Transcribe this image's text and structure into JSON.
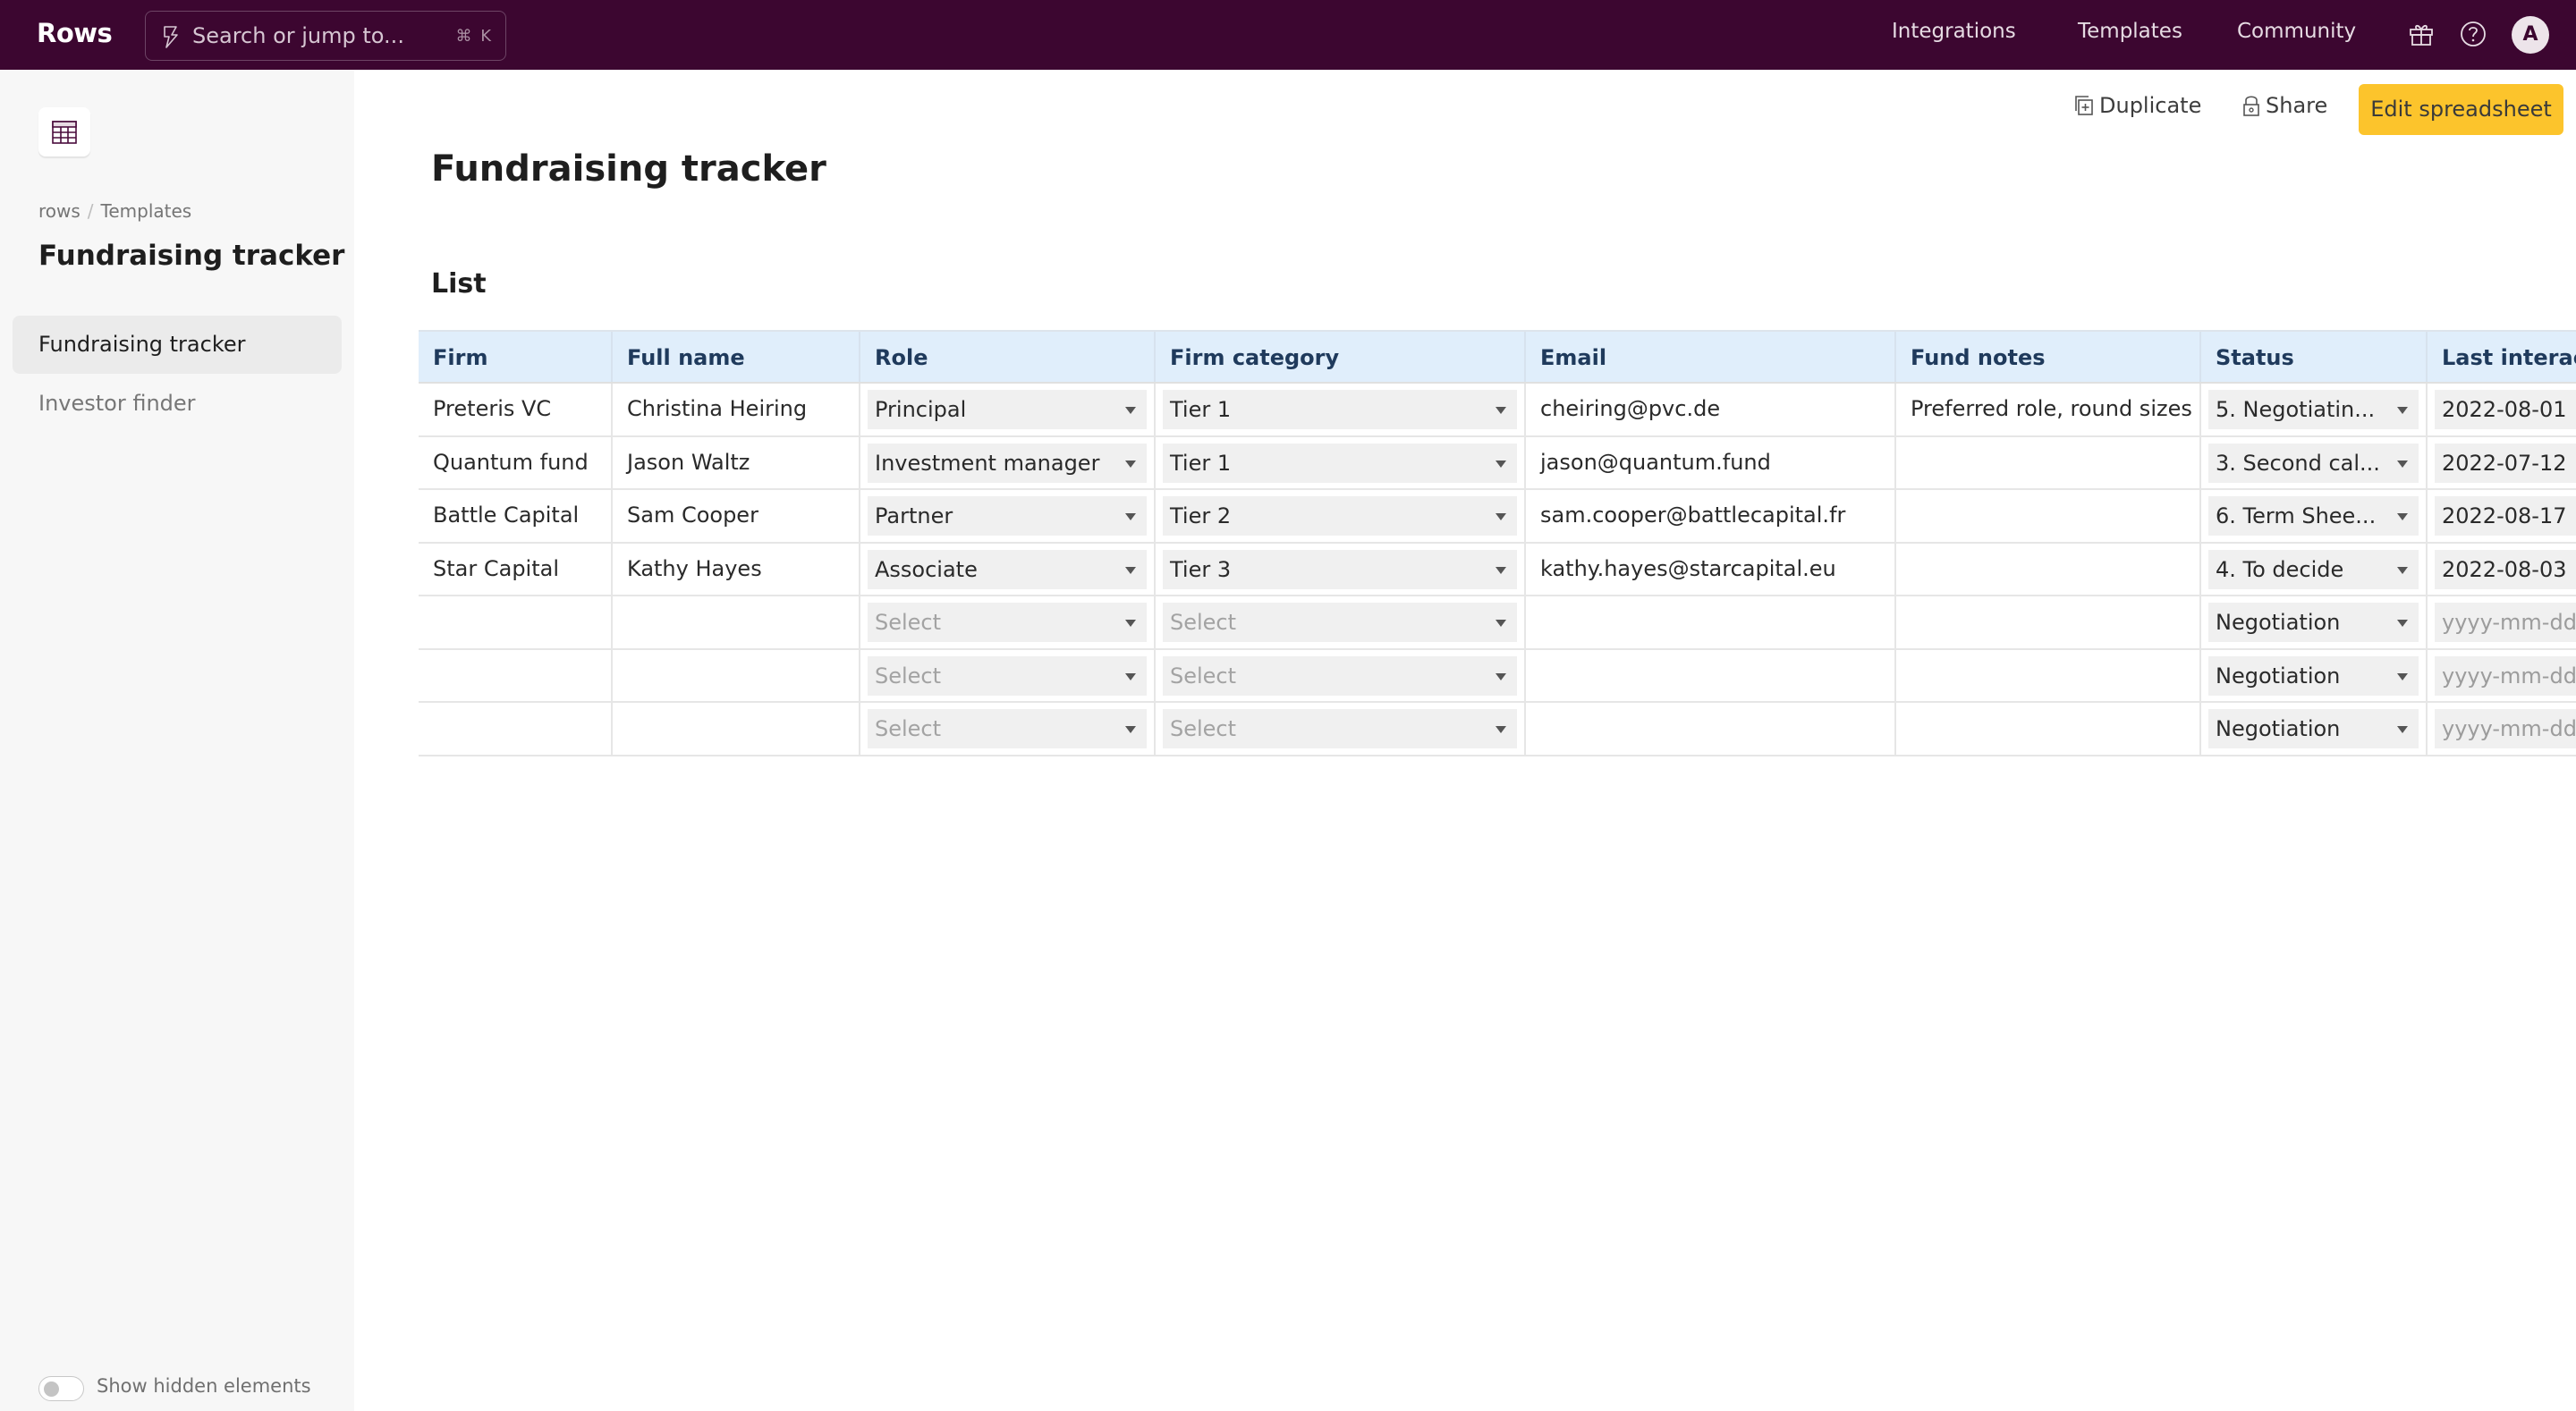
{
  "topbar": {
    "logo": "Rows",
    "search_placeholder": "Search or jump to...",
    "search_shortcut": "⌘ K",
    "nav": [
      "Integrations",
      "Templates",
      "Community"
    ],
    "avatar_initial": "A",
    "bg_color": "#3c0630"
  },
  "sidebar": {
    "breadcrumb": [
      "rows",
      "Templates"
    ],
    "title": "Fundraising tracker",
    "items": [
      {
        "label": "Fundraising tracker",
        "active": true
      },
      {
        "label": "Investor finder",
        "active": false
      }
    ],
    "toggle_label": "Show hidden elements",
    "toggle_on": false
  },
  "actions": {
    "duplicate": "Duplicate",
    "share": "Share",
    "edit": "Edit spreadsheet",
    "edit_color": "#fcc42c"
  },
  "page": {
    "title": "Fundraising tracker",
    "section": "List"
  },
  "table": {
    "columns": [
      "Firm",
      "Full name",
      "Role",
      "Firm category",
      "Email",
      "Fund notes",
      "Status",
      "Last interact"
    ],
    "rows": [
      {
        "firm": "Preteris VC",
        "name": "Christina Heiring",
        "role": "Principal",
        "category": "Tier 1",
        "email": "cheiring@pvc.de",
        "notes": "Preferred role, round sizes",
        "status": "5. Negotiatin...",
        "last": "2022-08-01"
      },
      {
        "firm": "Quantum fund",
        "name": "Jason Waltz",
        "role": "Investment manager",
        "category": "Tier 1",
        "email": "jason@quantum.fund",
        "notes": "",
        "status": "3. Second cal...",
        "last": "2022-07-12"
      },
      {
        "firm": "Battle Capital",
        "name": "Sam Cooper",
        "role": "Partner",
        "category": "Tier 2",
        "email": "sam.cooper@battlecapital.fr",
        "notes": "",
        "status": "6. Term Shee...",
        "last": "2022-08-17"
      },
      {
        "firm": "Star Capital",
        "name": "Kathy Hayes",
        "role": "Associate",
        "category": "Tier 3",
        "email": "kathy.hayes@starcapital.eu",
        "notes": "",
        "status": "4. To decide",
        "last": "2022-08-03"
      },
      {
        "firm": "",
        "name": "",
        "role": "",
        "category": "",
        "email": "",
        "notes": "",
        "status": "Negotiation",
        "last": ""
      },
      {
        "firm": "",
        "name": "",
        "role": "",
        "category": "",
        "email": "",
        "notes": "",
        "status": "Negotiation",
        "last": ""
      },
      {
        "firm": "",
        "name": "",
        "role": "",
        "category": "",
        "email": "",
        "notes": "",
        "status": "Negotiation",
        "last": ""
      }
    ],
    "select_placeholder": "Select",
    "date_placeholder": "yyyy-mm-dd",
    "header_color": "#e0eefb"
  }
}
